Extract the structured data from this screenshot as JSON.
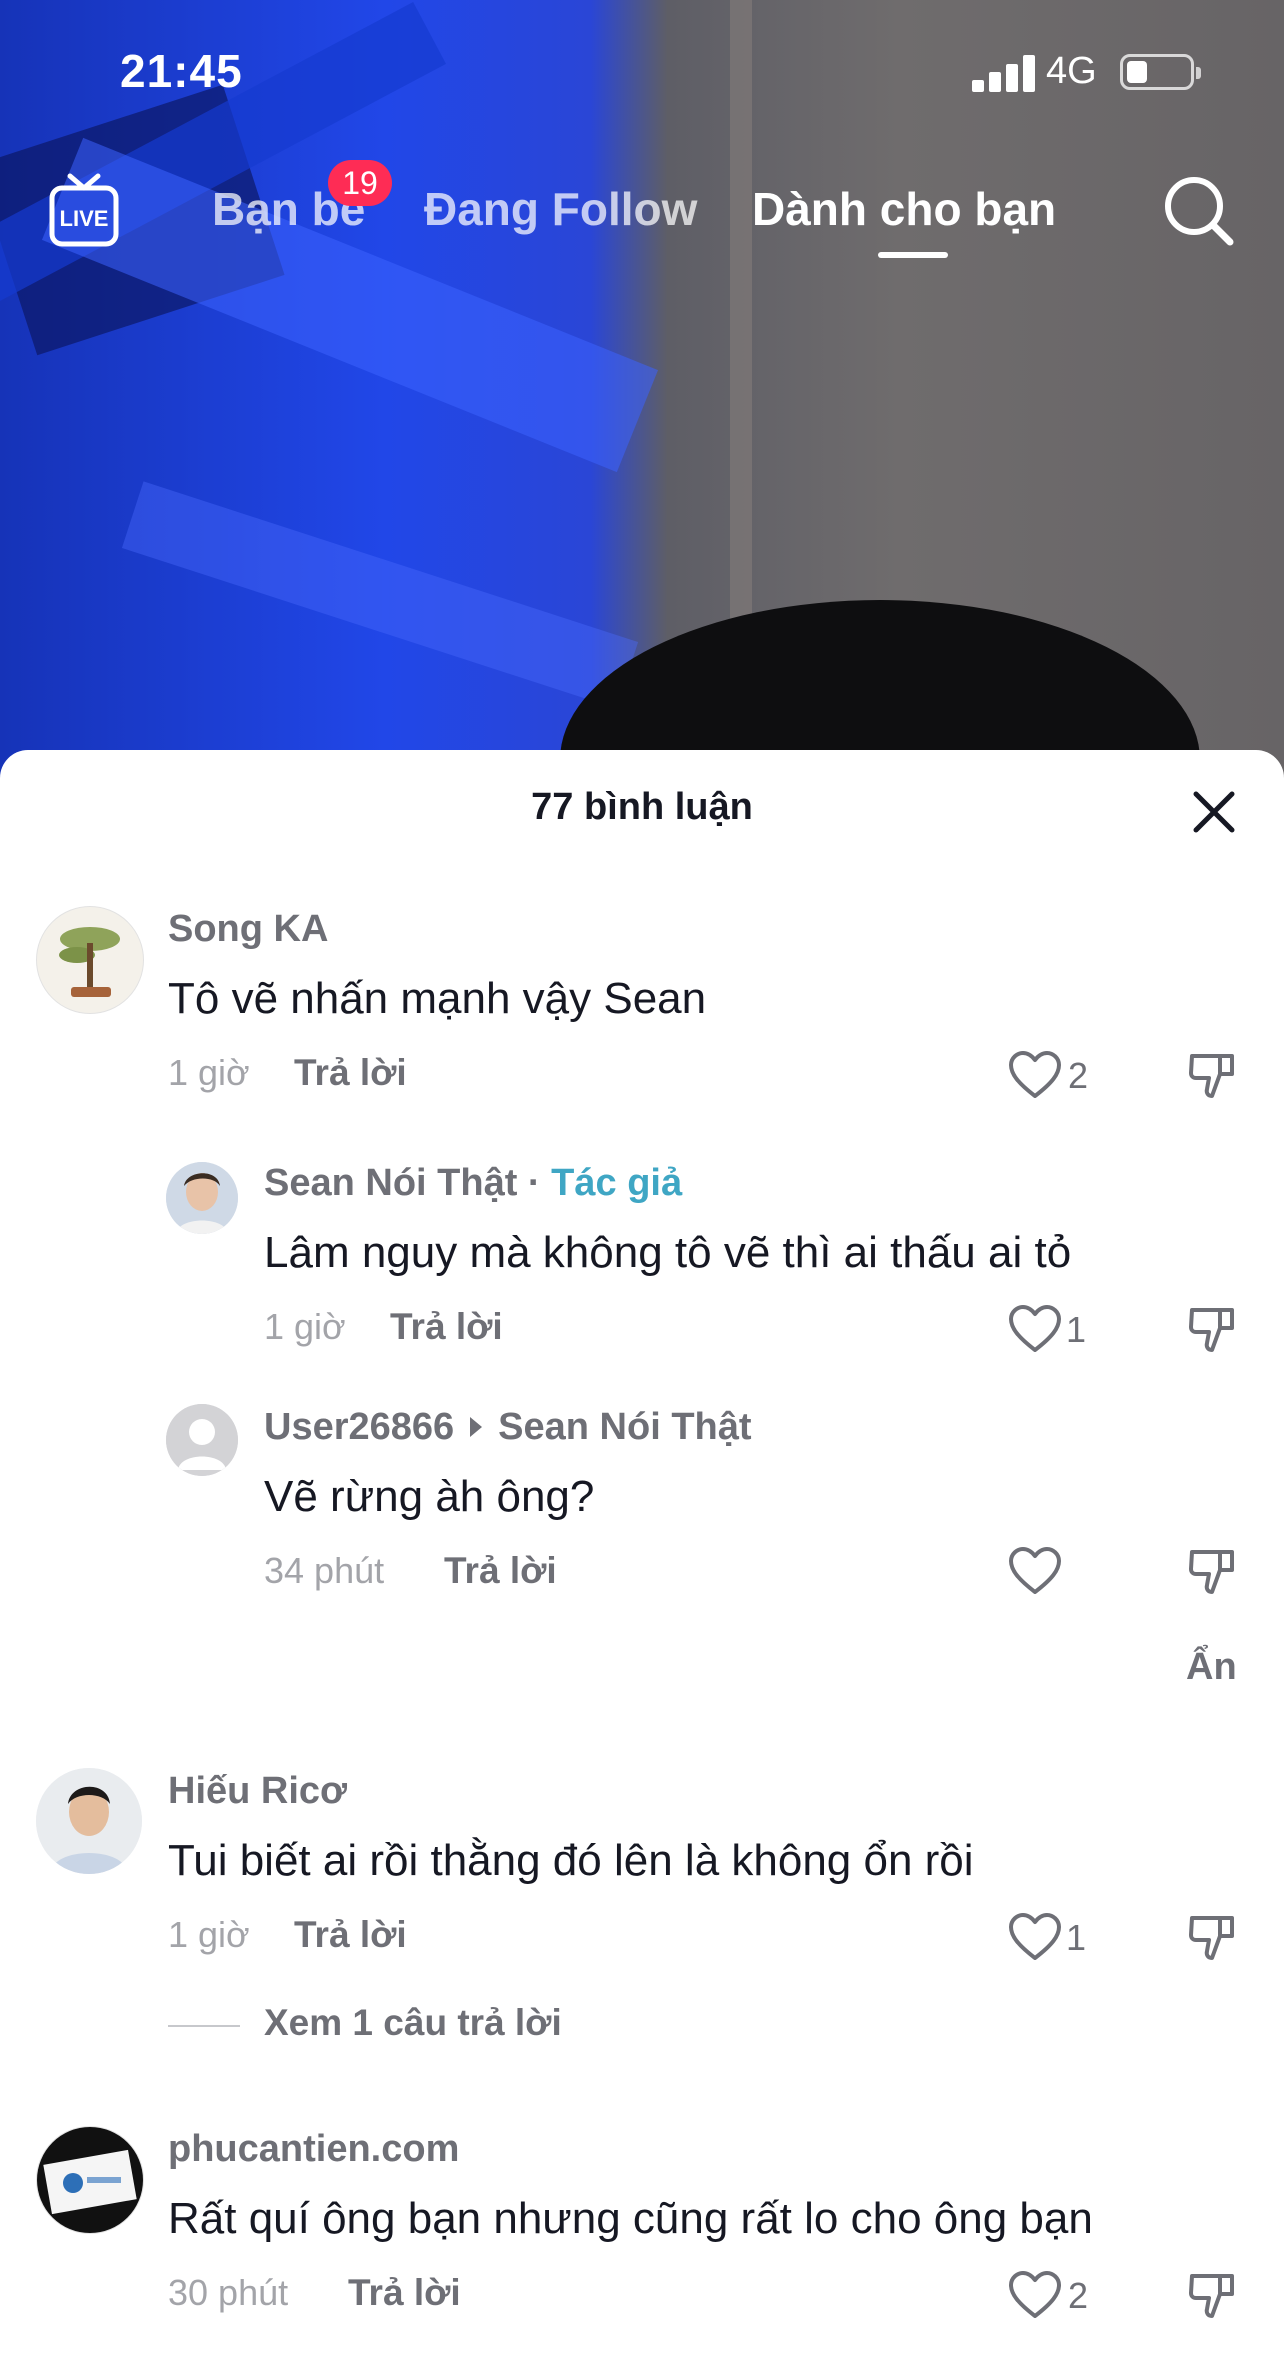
{
  "status_bar": {
    "time": "21:45",
    "network": "4G"
  },
  "top_nav": {
    "live_label": "LIVE",
    "tabs": [
      {
        "label": "Bạn bè",
        "badge": "19"
      },
      {
        "label": "Đang Follow"
      },
      {
        "label": "Dành cho bạn",
        "active": true
      }
    ]
  },
  "comments_sheet": {
    "title": "77 bình luận",
    "comments": [
      {
        "username": "Song KA",
        "text": "Tô vẽ nhấn mạnh vậy Sean",
        "time": "1 giờ",
        "reply_label": "Trả lời",
        "likes": "2",
        "replies": [
          {
            "username": "Sean Nói Thật",
            "author_tag": "Tác giả",
            "text": "Lâm nguy mà không tô vẽ thì ai thấu ai tỏ",
            "time": "1 giờ",
            "reply_label": "Trả lời",
            "likes": "1"
          },
          {
            "username": "User26866",
            "reply_to": "Sean Nói Thật",
            "text": "Vẽ rừng àh ông?",
            "time": "34 phút",
            "reply_label": "Trả lời",
            "likes": ""
          }
        ],
        "hide_label": "Ẩn"
      },
      {
        "username": "Hiếu Ricơ",
        "text": "Tui biết ai rồi thằng đó lên là không ổn rồi",
        "time": "1 giờ",
        "reply_label": "Trả lời",
        "likes": "1",
        "view_replies": "Xem 1 câu trả lời"
      },
      {
        "username": "phucantien.com",
        "text": "Rất quí ông bạn nhưng cũng rất lo cho ông bạn",
        "time": "30 phút",
        "reply_label": "Trả lời",
        "likes": "2"
      }
    ]
  },
  "colors": {
    "author_tag": "#3fa6c4",
    "badge": "#fe2c55",
    "text": "#161823",
    "muted": "#6e6f76"
  }
}
